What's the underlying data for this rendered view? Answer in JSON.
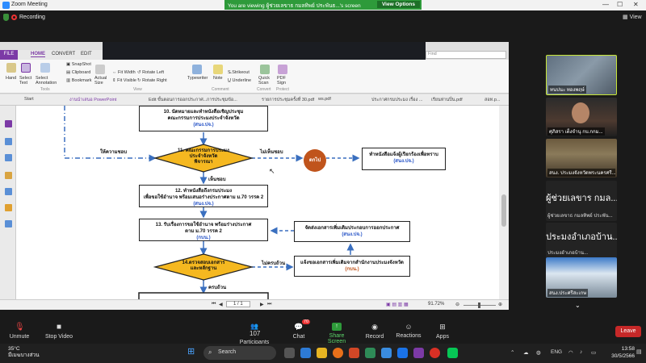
{
  "window": {
    "title": "Zoom Meeting"
  },
  "banner": {
    "text": "You are viewing ผู้ช่วยเลขาธ กมลทิพย์ ประพันธ...'s screen",
    "view_options": "View Options"
  },
  "topbar": {
    "recording": "Recording",
    "view": "View"
  },
  "pdf": {
    "ribbon_tabs": [
      "FILE",
      "HOME",
      "CONVERT",
      "EDIT"
    ],
    "ribbon_items": {
      "hand": "Hand",
      "select_text": "Select Text",
      "select_annotation": "Select Annotation",
      "snapshot": "SnapShot",
      "clipboard": "Clipboard",
      "bookmark": "Bookmark",
      "actual_size": "Actual Size",
      "fit_width": "Fit Width",
      "fit_visible": "Fit Visible",
      "rotate_left": "Rotate Left",
      "rotate_right": "Rotate Right",
      "typewriter": "Typewriter",
      "note": "Note",
      "strikeout": "Strikeout",
      "underline": "Underline",
      "quick_scan": "Quick Scan",
      "pdf_sign": "PDF Sign"
    },
    "ribbon_groups": {
      "tools": "Tools",
      "view": "View",
      "comment": "Comment",
      "convert": "Convert",
      "protect": "Protect"
    },
    "find_placeholder": "Find",
    "doc_tabs": [
      "Start",
      "งานนำเสนอ PowerPoint",
      "Edit ขั้นตอนการออกประกาศ...",
      "การประชุมข้อ...",
      "รายการประชุมครั้งที่ 30.pdf",
      "ws.pdf",
      "ประกาศกรมประมง เรื่อง ...",
      "เรียนท่านปิ่น.pdf",
      "สอท.p..."
    ],
    "status": {
      "page": "1 / 1",
      "zoom": "91.72%"
    }
  },
  "flowchart": {
    "step10": {
      "line1": "10. นัดหมายและทำหนังสือเชิญประชุม",
      "line2": "คณะกรรมการประมงประจำจังหวัด",
      "owner": "(สนง.ปจ.)"
    },
    "step11": {
      "line1": "11. คณะกรรมการประมง",
      "line2": "ประจำจังหวัด",
      "line3": "พิจารณา"
    },
    "step12": {
      "line1": "12. ทำหนังสือถึงกรมประมง",
      "line2": "เพื่อขอใช้อำนาจ พร้อมเสนอร่างประกาศตาม ม.70 วรรค 2",
      "owner": "(สนง.ปจ.)"
    },
    "step13": {
      "line1": "13. รับเรื่องการขอใช้อำนาจ พร้อมร่างประกาศ",
      "line2": "ตาม ม.70 วรรค 2",
      "owner": "(กบน.)"
    },
    "step14": {
      "line1": "14.ตรวจสอบเอกสาร",
      "line2": "และหลักฐาน"
    },
    "reply": {
      "line1": "ทำหนังสือแจ้งผู้เรียกร้องเพื่อทราบ",
      "owner": "(สนง.ปจ.)"
    },
    "prepare": {
      "line1": "จัดส่งเอกสารเพิ่มเติมประกอบการออกประกาศ",
      "owner": "(สนง.ปจ.)"
    },
    "notify": {
      "line1": "แจ้งขอเอกสารเพิ่มเติมจากสำนักงานประมงจังหวัด",
      "owner": "(กบน.)"
    },
    "end_circle": "ตกไป",
    "labels": {
      "approve": "ให้ความชอบ",
      "disapprove": "ไม่เห็นชอบ",
      "agree": "เห็นชอบ",
      "incomplete": "ไม่ครบถ้วน",
      "complete": "ครบถ้วน"
    }
  },
  "participants_panel": {
    "thumbs": [
      {
        "name": "ทนปนะ ทองพฤษ์"
      },
      {
        "name": "ศุภิสรา เต็งจำนุ กบ.กกม..."
      },
      {
        "name": "สนง. ประมงจังหวัดพระนครศรี..."
      }
    ],
    "names": [
      {
        "big": "ผู้ช่วยเลขาร กมล...",
        "small": "ผู้ช่วยเลขาธ กมลทิพย์ ประพัน..."
      },
      {
        "big": "ประมงอำเภอบ้าน...",
        "small": "ประมงอำเภอบ้าน..."
      }
    ],
    "last_thumb": {
      "name": "สนง.ประศรีสะเกษ"
    }
  },
  "toolbar": {
    "unmute": "Unmute",
    "stop_video": "Stop Video",
    "participants": "Participants",
    "participants_count": "107",
    "chat": "Chat",
    "chat_badge": "70",
    "share_screen": "Share Screen",
    "record": "Record",
    "reactions": "Reactions",
    "apps": "Apps",
    "leave": "Leave"
  },
  "taskbar": {
    "temp": "35°C",
    "weather": "มีเมฆบางส่วน",
    "search": "Search",
    "lang": "ENG",
    "time": "13:58",
    "date": "30/5/2566"
  }
}
